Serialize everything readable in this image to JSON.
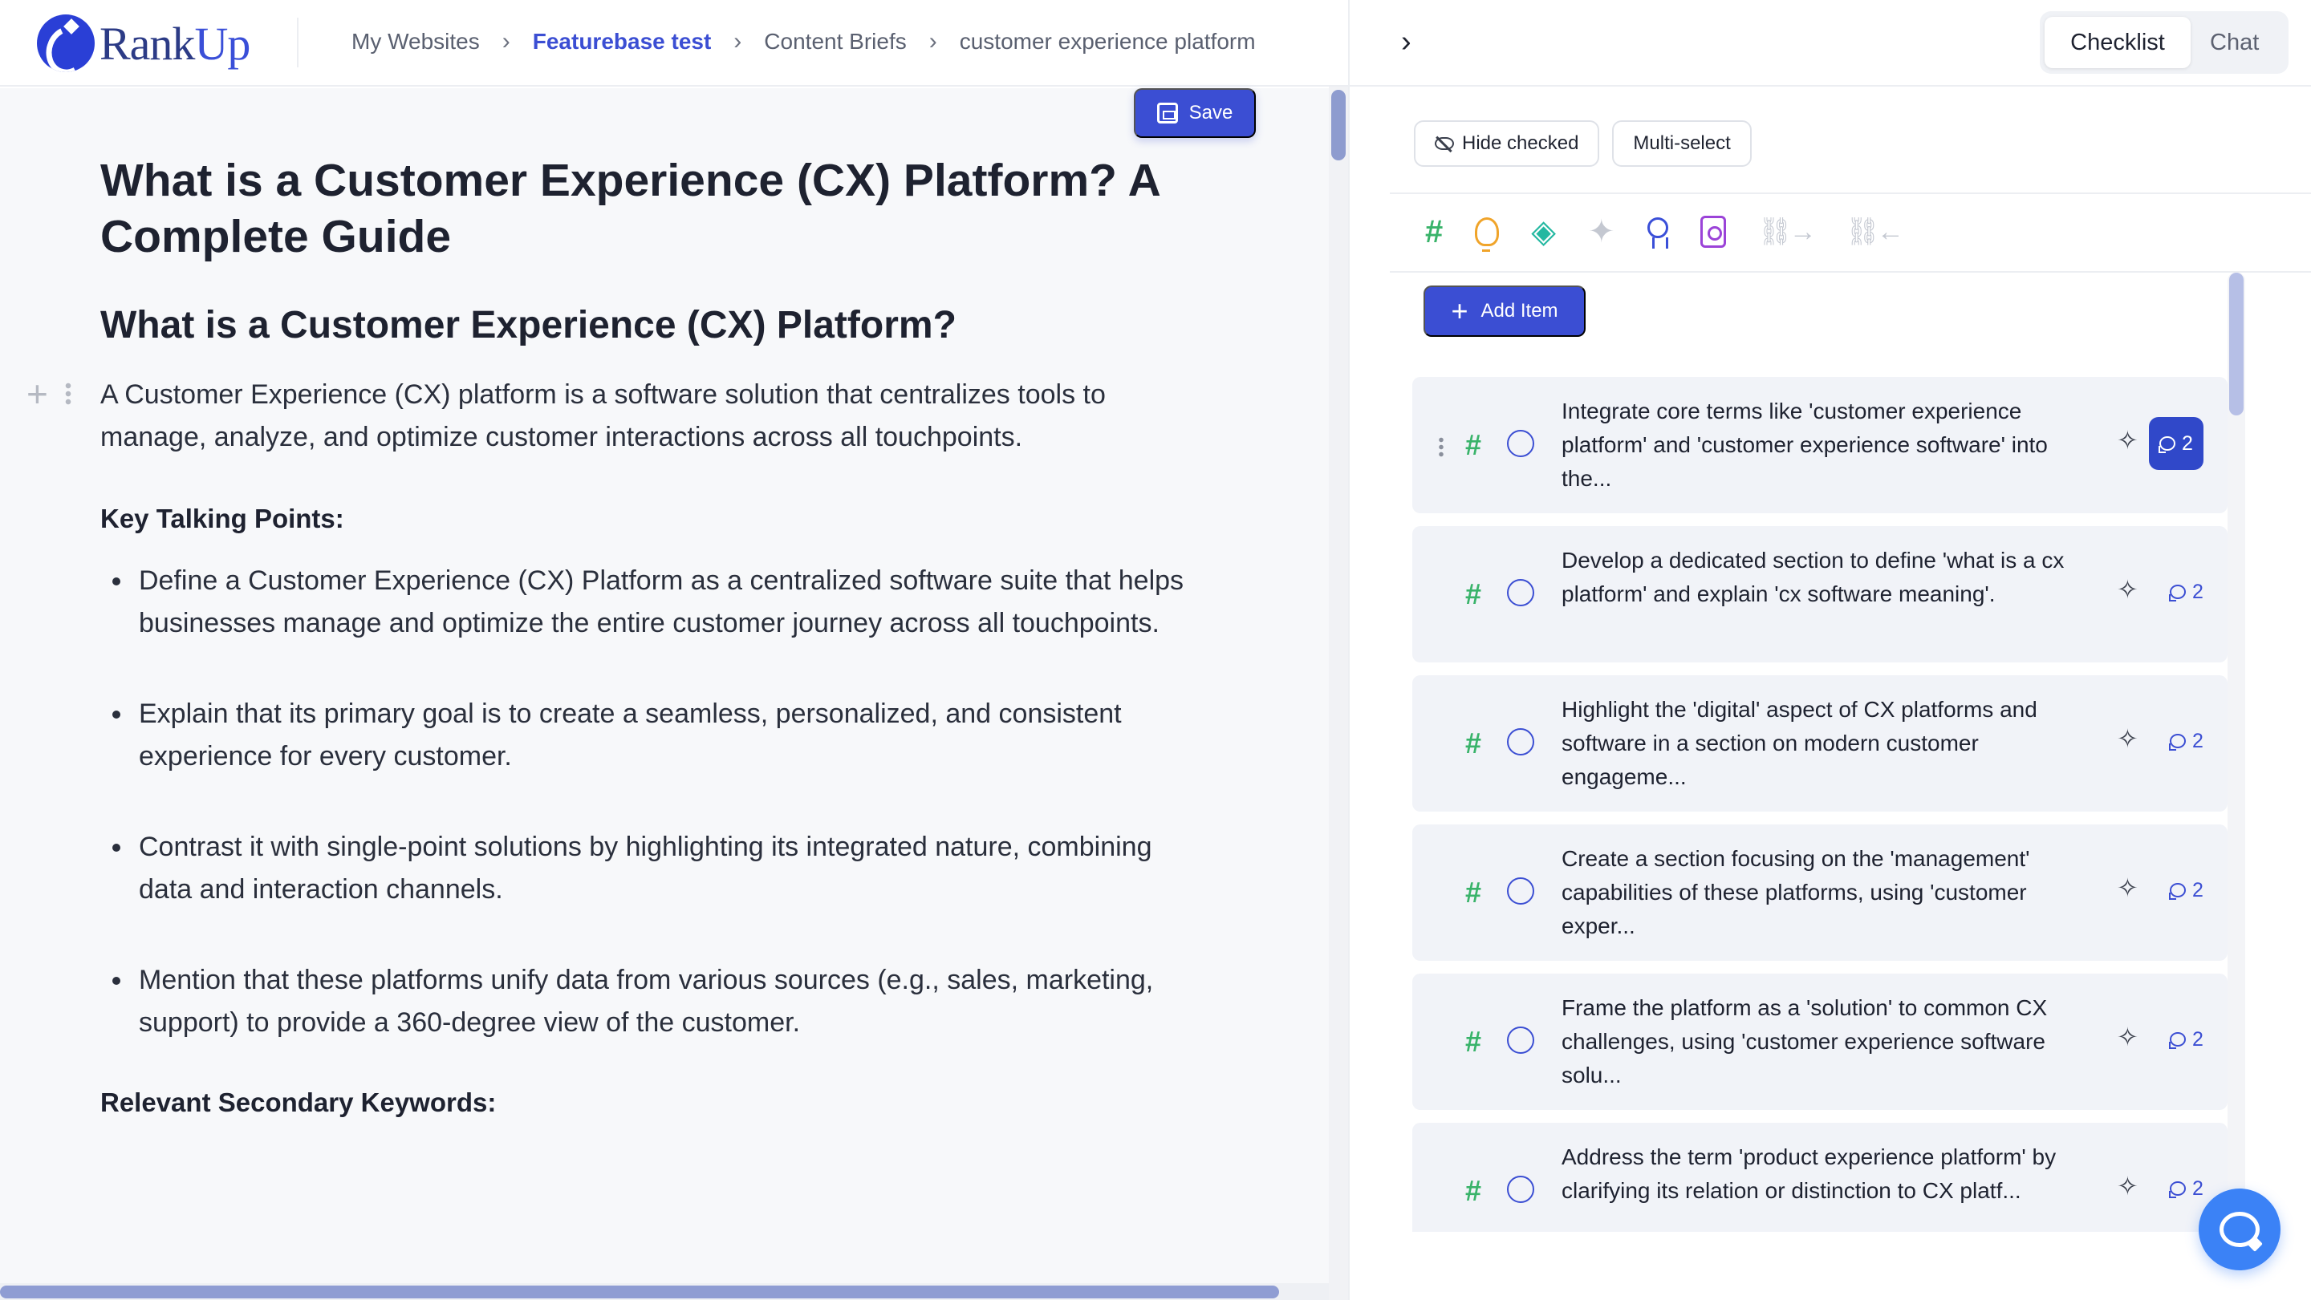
{
  "brand": {
    "name_main": "Rank",
    "name_accent": "Up"
  },
  "breadcrumb": [
    "My Websites",
    "Featurebase test",
    "Content Briefs",
    "customer experience platform"
  ],
  "panel_tabs": {
    "checklist": "Checklist",
    "chat": "Chat"
  },
  "editor": {
    "save_label": "Save",
    "title": "What is a Customer Experience (CX) Platform? A Complete Guide",
    "h2": "What is a Customer Experience (CX) Platform?",
    "intro": "A Customer Experience (CX) platform is a software solution that centralizes tools to manage, analyze, and optimize customer interactions across all touchpoints.",
    "key_points_label": "Key Talking Points:",
    "bullets": [
      "Define a Customer Experience (CX) Platform as a centralized software suite that helps businesses manage and optimize the entire customer journey across all touchpoints.",
      "Explain that its primary goal is to create a seamless, personalized, and consistent experience for every customer.",
      "Contrast it with single-point solutions by highlighting its integrated nature, combining data and interaction channels.",
      "Mention that these platforms unify data from various sources (e.g., sales, marketing, support) to provide a 360-degree view of the customer."
    ],
    "secondary_label": "Relevant Secondary Keywords:"
  },
  "checklist": {
    "filters": {
      "hide_checked": "Hide checked",
      "multi_select": "Multi-select"
    },
    "add_item_label": "Add Item",
    "items": [
      {
        "text": "Integrate core terms like 'customer experience platform' and 'customer experience software' into the...",
        "comments": "2"
      },
      {
        "text": "Develop a dedicated section to define 'what is a cx platform' and explain 'cx software meaning'.",
        "comments": "2"
      },
      {
        "text": "Highlight the 'digital' aspect of CX platforms and software in a section on modern customer engageme...",
        "comments": "2"
      },
      {
        "text": "Create a section focusing on the 'management' capabilities of these platforms, using 'customer exper...",
        "comments": "2"
      },
      {
        "text": "Frame the platform as a 'solution' to common CX challenges, using 'customer experience software solu...",
        "comments": "2"
      },
      {
        "text": "Address the term 'product experience platform' by clarifying its relation or distinction to CX platf...",
        "comments": "2"
      }
    ]
  },
  "colors": {
    "accent": "#3b4ed3",
    "keyword_green": "#39b36a",
    "fab_blue": "#3b82f6"
  }
}
